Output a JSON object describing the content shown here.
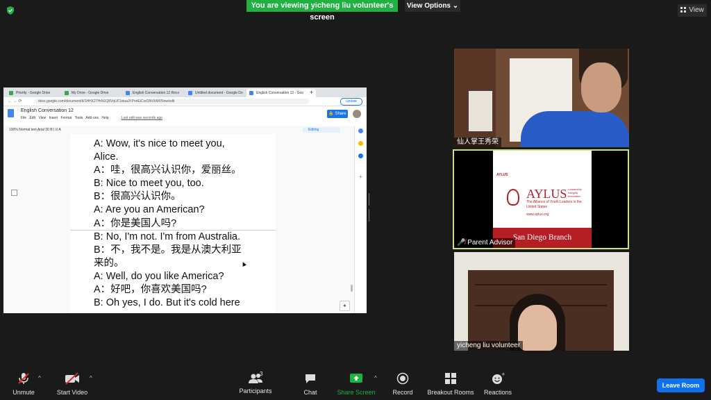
{
  "banner": {
    "text": "You are viewing yicheng liu volunteer's screen"
  },
  "view_options": {
    "label": "View Options"
  },
  "view_button": {
    "label": "View"
  },
  "browser": {
    "tabs": [
      {
        "label": "Priority - Google Drive"
      },
      {
        "label": "My Drive - Google Drive"
      },
      {
        "label": "English Conversation 12 Reco"
      },
      {
        "label": "Untitled document - Google Do"
      },
      {
        "label": "English Conversation 12 - Goo"
      }
    ],
    "url": "docs.google.com/document/d/1HHX27HrN1Q8VqUF1stuaJf-PonEiCsrO5tVkMXNnw/edit",
    "update_label": "Update"
  },
  "doc": {
    "title": "English Conversation 12",
    "menu": "File Edit View Insert Format Tools Add-ons Help",
    "last_edit": "Last edit was seconds ago",
    "share_label": "Share",
    "toolbar_text": "100%    Normal text    Arial    30    B  I  U  A",
    "editing_label": "Editing",
    "lines": [
      "A: Wow, it's nice to meet you,",
      "Alice.",
      "A：哇，很高兴认识你，爱丽丝。",
      "B: Nice to meet you, too.",
      "B：很高兴认识你。",
      "A: Are you an American?",
      "A：你是美国人吗?",
      "B: No, I'm not. I'm from Australia.",
      "B：不，我不是。我是从澳大利亚",
      "来的。",
      "A: Well, do you like America?",
      "A：好吧，你喜欢美国吗?",
      "B: Oh yes, I do. But it's cold here"
    ]
  },
  "videos": [
    {
      "name": "仙人掌王秀荣"
    },
    {
      "name": "Parent Advisor"
    },
    {
      "name": "yicheng liu volunteer"
    }
  ],
  "aylus": {
    "small": "AYLUS",
    "big": "AYLUS",
    "tagline": "The Alliance of Youth Leaders in the United States",
    "url": "www.aylus.org",
    "sub": "Leadership Integrity Innovation",
    "branch": "San Diego Branch"
  },
  "controls": {
    "unmute": "Unmute",
    "start_video": "Start Video",
    "participants": "Participants",
    "participants_count": "3",
    "chat": "Chat",
    "share_screen": "Share Screen",
    "record": "Record",
    "breakout": "Breakout Rooms",
    "reactions": "Reactions",
    "leave": "Leave Room"
  },
  "colors": {
    "banner": "#1fb141",
    "leave": "#0e72ed",
    "aylus_red": "#b51f23",
    "active_speaker": "#c7e67a"
  }
}
